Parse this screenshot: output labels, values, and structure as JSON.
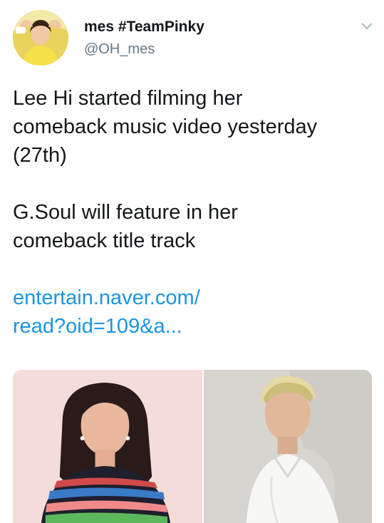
{
  "author": {
    "display_name": "mes #TeamPinky",
    "handle": "@OH_mes"
  },
  "tweet": {
    "paragraph_1": [
      "Lee Hi started filming her",
      "comeback music video yesterday",
      "(27th)"
    ],
    "paragraph_2": [
      "G.Soul will feature in her",
      "comeback title track"
    ],
    "link_lines": [
      "entertain.naver.com/",
      "read?oid=109&a..."
    ]
  },
  "icons": {
    "more": "chevron-down-icon"
  },
  "colors": {
    "link": "#1b95e0",
    "handle": "#657786",
    "text": "#14171a"
  }
}
